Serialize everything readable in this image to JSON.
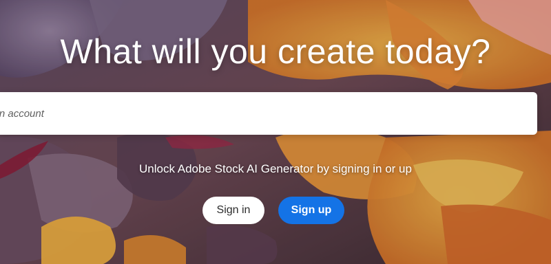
{
  "hero": {
    "title": "What will you create today?"
  },
  "prompt": {
    "placeholder": "e an account"
  },
  "unlock": {
    "text": "Unlock Adobe Stock AI Generator by signing in or up"
  },
  "actions": {
    "sign_in_label": "Sign in",
    "sign_up_label": "Sign up"
  },
  "colors": {
    "sign_up_accent": "#1473e6",
    "sign_in_bg": "#ffffff"
  }
}
